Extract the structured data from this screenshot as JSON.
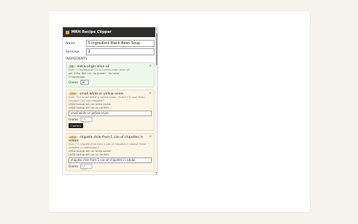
{
  "app": {
    "title": "MRH Recipe Clipper"
  },
  "form": {
    "name_label": "Name",
    "name_value": "5-Ingredient Black Bean Soup",
    "servings_label": "Servings",
    "servings_value": "2",
    "ingredients_heading": "INGREDIENTS"
  },
  "ingredients": [
    {
      "badge": "OK",
      "title": "extra-virgin olive oil",
      "from": "from: \"1 tablespoon (15 ml) extra-virgin olive oil\"",
      "per": "per 100g: 884 cal · 0g protein · 0g carbs",
      "qty": "2 tablespoon",
      "grams_label": "Grams:",
      "grams_value": "30",
      "close": "×"
    },
    {
      "badge": "NEW",
      "title": "small white or yellow onion",
      "from": "from: \"1/2 small white or yellow onion, (Scant 1/2 cup) finely chopped (1/2 cup chopped)\"",
      "usda1": "USDA lookup will run when saved",
      "usda2": "USDA lookup will run on confirm",
      "input_value": "small white or yellow onion",
      "grams_label": "Grams:",
      "grams_placeholder": "e.g. 200",
      "confirm": "Confirm",
      "close": "×"
    },
    {
      "badge": "NEW",
      "title": "chipotle chile from 1 can of chipotles in adobo",
      "from": "from: \"1 chipotle chile from 1 can of chipotles in adobo, finely chopped (1 tablespoon)\"",
      "usda1": "USDA lookup will run when saved",
      "usda2": "USDA lookup will run on confirm",
      "input_value": "chipotle chile from 1 can of chipotles in adobo",
      "grams_label": "Grams:",
      "grams_placeholder": "e.g. 200",
      "close": "×"
    }
  ],
  "colors": {
    "header_bg": "#2f2d2a",
    "ok_bg": "#ecf8e8",
    "new_bg": "#fcf4e4"
  }
}
